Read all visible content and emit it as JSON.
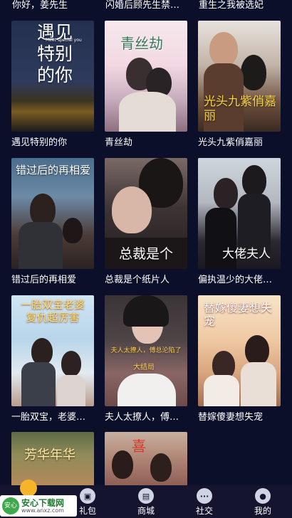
{
  "top_titles": [
    "你好，姜先生",
    "闪婚后顾先生禁…",
    "重生之我被选妃"
  ],
  "dramas": [
    {
      "title": "遇见特别的你",
      "poster_text": "遇见特别的你",
      "poster_sub": "Meet special you"
    },
    {
      "title": "青丝劫",
      "poster_text": "青丝劫"
    },
    {
      "title": "光头九紫俏嘉丽",
      "poster_text": "光头九紫俏嘉丽"
    },
    {
      "title": "错过后的再相爱",
      "poster_text": "错过后的再相爱"
    },
    {
      "title": "总裁是个纸片人",
      "poster_text": "总裁是个"
    },
    {
      "title": "偏执温少的大佬…",
      "poster_text": "大佬夫人"
    },
    {
      "title": "一胎双宝，老婆…",
      "poster_text": "一胎双宝老婆复仇超厉害"
    },
    {
      "title": "夫人太撩人，傅…",
      "poster_text": "夫人太撩人，傅总沦陷了",
      "poster_sub": "大结局"
    },
    {
      "title": "替嫁傻妻想失宠",
      "poster_text": "替嫁傻妻想失宠"
    },
    {
      "title": "",
      "poster_text": "芳华年华"
    },
    {
      "title": "",
      "poster_text": "喜"
    }
  ],
  "nav": [
    {
      "label": "礼包",
      "icon": "gift-icon"
    },
    {
      "label": "商城",
      "icon": "shop-icon"
    },
    {
      "label": "社交",
      "icon": "chat-icon"
    },
    {
      "label": "我的",
      "icon": "user-icon"
    }
  ],
  "watermark": {
    "site": "安心下载网",
    "url": "www.anxz.com",
    "logo_text": "安心"
  }
}
